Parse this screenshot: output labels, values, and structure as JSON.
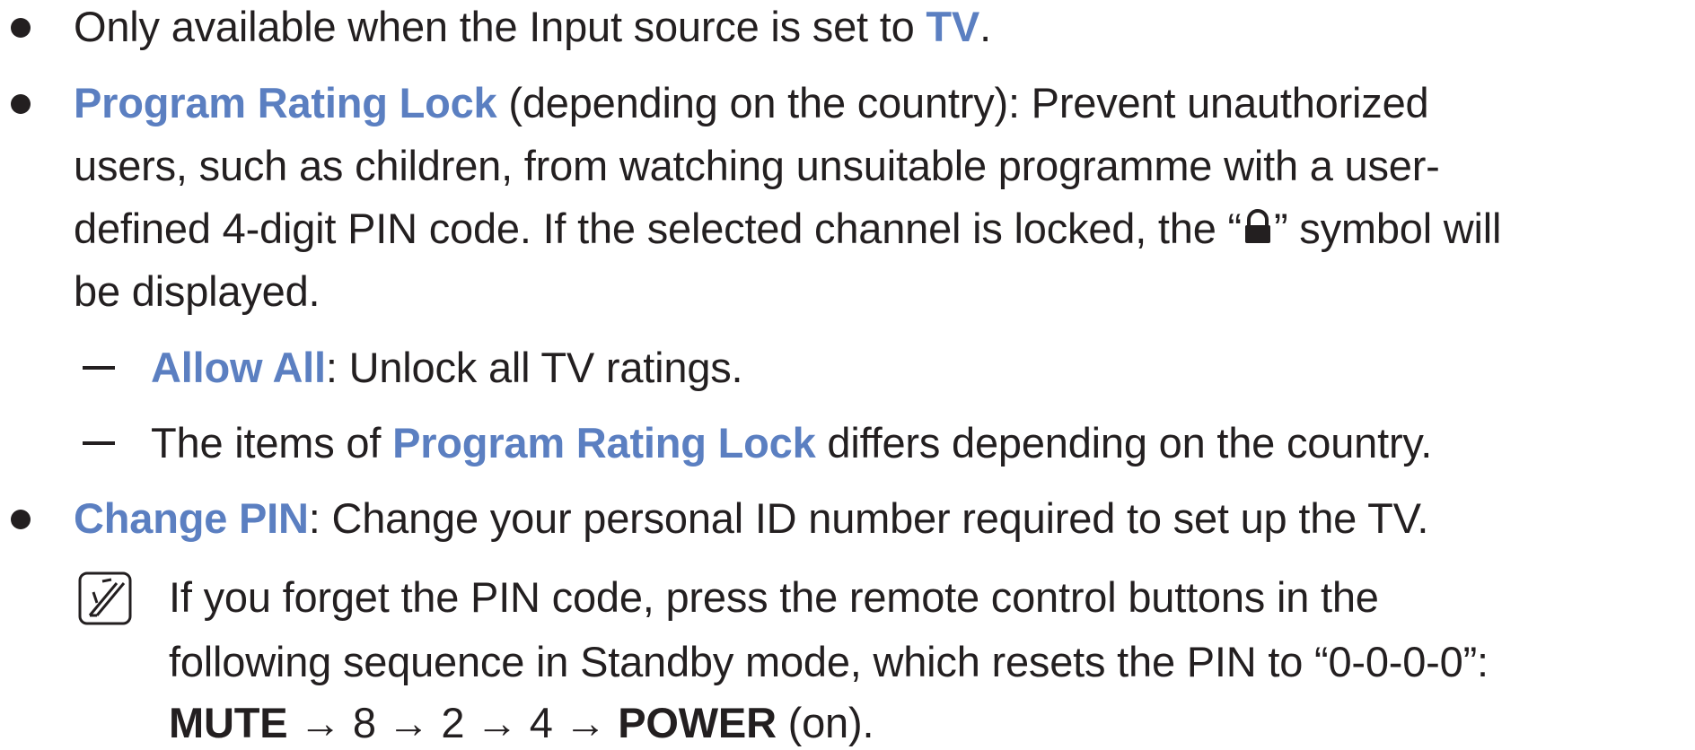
{
  "item1": {
    "prefix": "Only available when the Input source is set to ",
    "highlight": "TV",
    "suffix": "."
  },
  "item2": {
    "term": "Program Rating Lock",
    "line1_rest": " (depending on the country): Prevent unauthorized",
    "line2": "users, such as children, from watching unsuitable programme with a user-",
    "line3_before_icon": "defined 4-digit PIN code. If the selected channel is locked, the “",
    "line3_after_icon": "” symbol will",
    "line4": "be displayed.",
    "icon": "lock-icon"
  },
  "sub1": {
    "term": "Allow All",
    "rest": ": Unlock all TV ratings."
  },
  "sub2": {
    "prefix": "The items of ",
    "term": "Program Rating Lock",
    "suffix": " differs depending on the country."
  },
  "item3": {
    "term": "Change PIN",
    "rest": ": Change your personal ID number required to set up the TV."
  },
  "note": {
    "icon": "note-icon",
    "line1": "If you forget the PIN code, press the remote control buttons in the",
    "line2": "following sequence in Standby mode, which resets the PIN to “0-0-0-0”:",
    "mute": "MUTE",
    "seq": " → 8 → 2 → 4 → ",
    "power": "POWER",
    "on": " (on)."
  },
  "colors": {
    "highlight": "#5b7fc1",
    "text": "#231f20"
  }
}
